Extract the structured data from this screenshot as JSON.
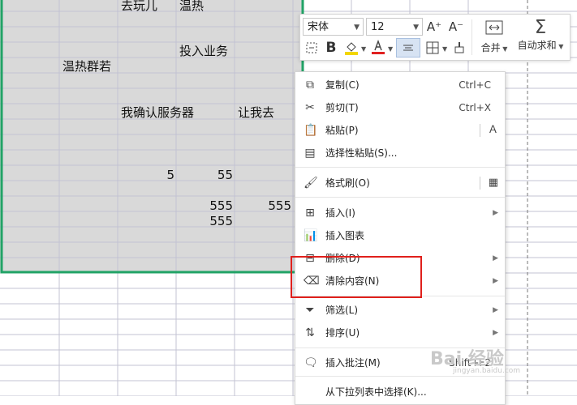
{
  "cells": {
    "r0c2": "去玩儿",
    "r0c3": "温热",
    "r2c3": "投入业务",
    "r3c1": "温热群若",
    "r5c2": "我确认服务器",
    "r5c4": "让我去",
    "num_a": "5",
    "num_b": "55",
    "num_c": "555",
    "num_d": "555",
    "num_e": "555"
  },
  "mini_toolbar": {
    "font_name": "宋体",
    "font_size": "12",
    "increase_font": "A⁺",
    "decrease_font": "A⁻",
    "merge_label": "合并",
    "autosum_label": "自动求和",
    "font_color": "#e02020",
    "fill_color": "#f2d600"
  },
  "context_menu": {
    "items": [
      {
        "label": "复制(C)",
        "shortcut": "Ctrl+C",
        "icon": "copy-icon"
      },
      {
        "label": "剪切(T)",
        "shortcut": "Ctrl+X",
        "icon": "cut-icon"
      },
      {
        "label": "粘贴(P)",
        "icon": "paste-icon"
      },
      {
        "label": "选择性粘贴(S)...",
        "icon": "paste-special-icon"
      },
      {
        "label": "格式刷(O)",
        "icon": "format-painter-icon"
      },
      {
        "label": "插入(I)",
        "icon": "insert-icon"
      },
      {
        "label": "插入图表",
        "icon": "chart-icon"
      },
      {
        "label": "删除(D)",
        "icon": "delete-icon"
      },
      {
        "label": "清除内容(N)",
        "icon": "clear-content-icon"
      },
      {
        "label": "筛选(L)",
        "icon": "filter-icon"
      },
      {
        "label": "排序(U)",
        "icon": "sort-icon"
      },
      {
        "label": "插入批注(M)",
        "shortcut": "Shift+F2",
        "icon": "comment-icon"
      },
      {
        "label": "从下拉列表中选择(K)...",
        "icon": "dropdown-list-icon"
      }
    ]
  },
  "watermark": {
    "main": "Bai 经验",
    "sub": "jingyan.baidu.com"
  },
  "colors": {
    "selection_border": "#21a366",
    "selection_fill": "#d9d9d9",
    "highlight_box": "#e0201c",
    "gridline": "#c9c9d9"
  }
}
